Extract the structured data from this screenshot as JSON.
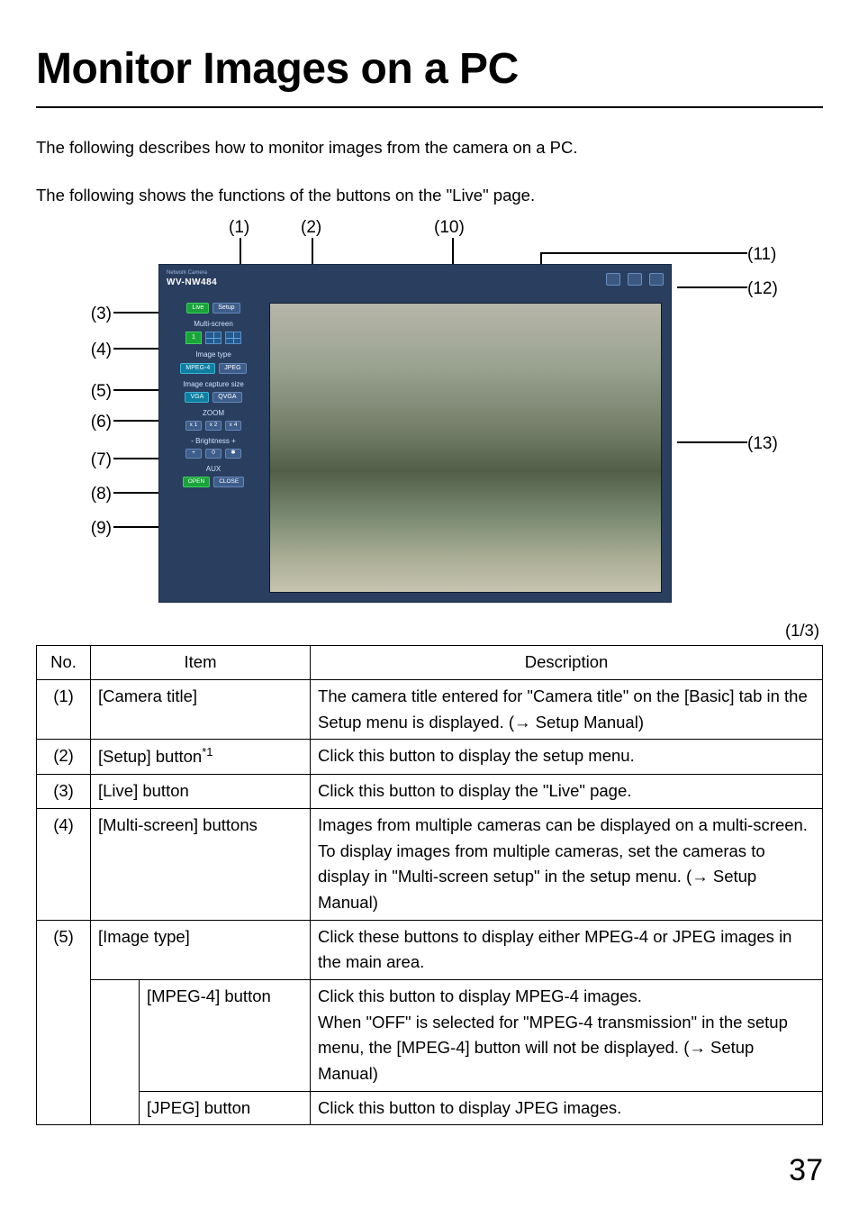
{
  "title": "Monitor Images on a PC",
  "intro1": "The following describes how to monitor images from the camera on a PC.",
  "intro2": "The following shows the functions of the buttons on the \"Live\" page.",
  "page_indicator": "(1/3)",
  "page_number": "37",
  "screenshot": {
    "brand_line": "Network Camera",
    "model": "WV-NW484",
    "tabs": {
      "live": "Live",
      "setup": "Setup"
    },
    "sections": {
      "multiscreen": "Multi-screen",
      "image_type": "Image type",
      "capture_size": "Image capture size",
      "zoom": "ZOOM",
      "brightness": "-  Brightness  +",
      "aux": "AUX"
    },
    "buttons": {
      "mpeg4": "MPEG-4",
      "jpeg": "JPEG",
      "vga": "VGA",
      "qvga": "QVGA",
      "z1": "x 1",
      "z2": "x 2",
      "z4": "x 4",
      "b_minus": "+",
      "b_zero": "0",
      "b_star": "✱",
      "open": "OPEN",
      "close": "CLOSE",
      "ms1": "1"
    }
  },
  "callouts": {
    "c1": "(1)",
    "c2": "(2)",
    "c3": "(3)",
    "c4": "(4)",
    "c5": "(5)",
    "c6": "(6)",
    "c7": "(7)",
    "c8": "(8)",
    "c9": "(9)",
    "c10": "(10)",
    "c11": "(11)",
    "c12": "(12)",
    "c13": "(13)"
  },
  "table": {
    "headers": {
      "no": "No.",
      "item": "Item",
      "desc": "Description"
    },
    "rows": [
      {
        "no": "(1)",
        "item": "[Camera title]",
        "desc": "The camera title entered for \"Camera title\" on the [Basic] tab in the Setup menu is displayed. (→ Setup Manual)"
      },
      {
        "no": "(2)",
        "item_html": "[Setup] button<sup>*1</sup>",
        "item": "[Setup] button*1",
        "desc": "Click this button to display the setup menu."
      },
      {
        "no": "(3)",
        "item": "[Live] button",
        "desc": "Click this button to display the \"Live\" page."
      },
      {
        "no": "(4)",
        "item": "[Multi-screen] buttons",
        "desc": "Images from multiple cameras can be displayed on a multi-screen. To display images from multiple cameras, set the cameras to display in \"Multi-screen setup\" in the setup menu. (→ Setup Manual)"
      },
      {
        "no": "(5)",
        "item": "[Image type]",
        "desc": "Click these buttons to display either MPEG-4 or JPEG images in the main area.",
        "sub": [
          {
            "item": "[MPEG-4] button",
            "desc": "Click this button to display MPEG-4 images.\nWhen \"OFF\" is selected for \"MPEG-4 transmission\" in the setup menu, the [MPEG-4] button will not be displayed. (→ Setup Manual)"
          },
          {
            "item": "[JPEG] button",
            "desc": "Click this button to display JPEG images."
          }
        ]
      }
    ]
  }
}
